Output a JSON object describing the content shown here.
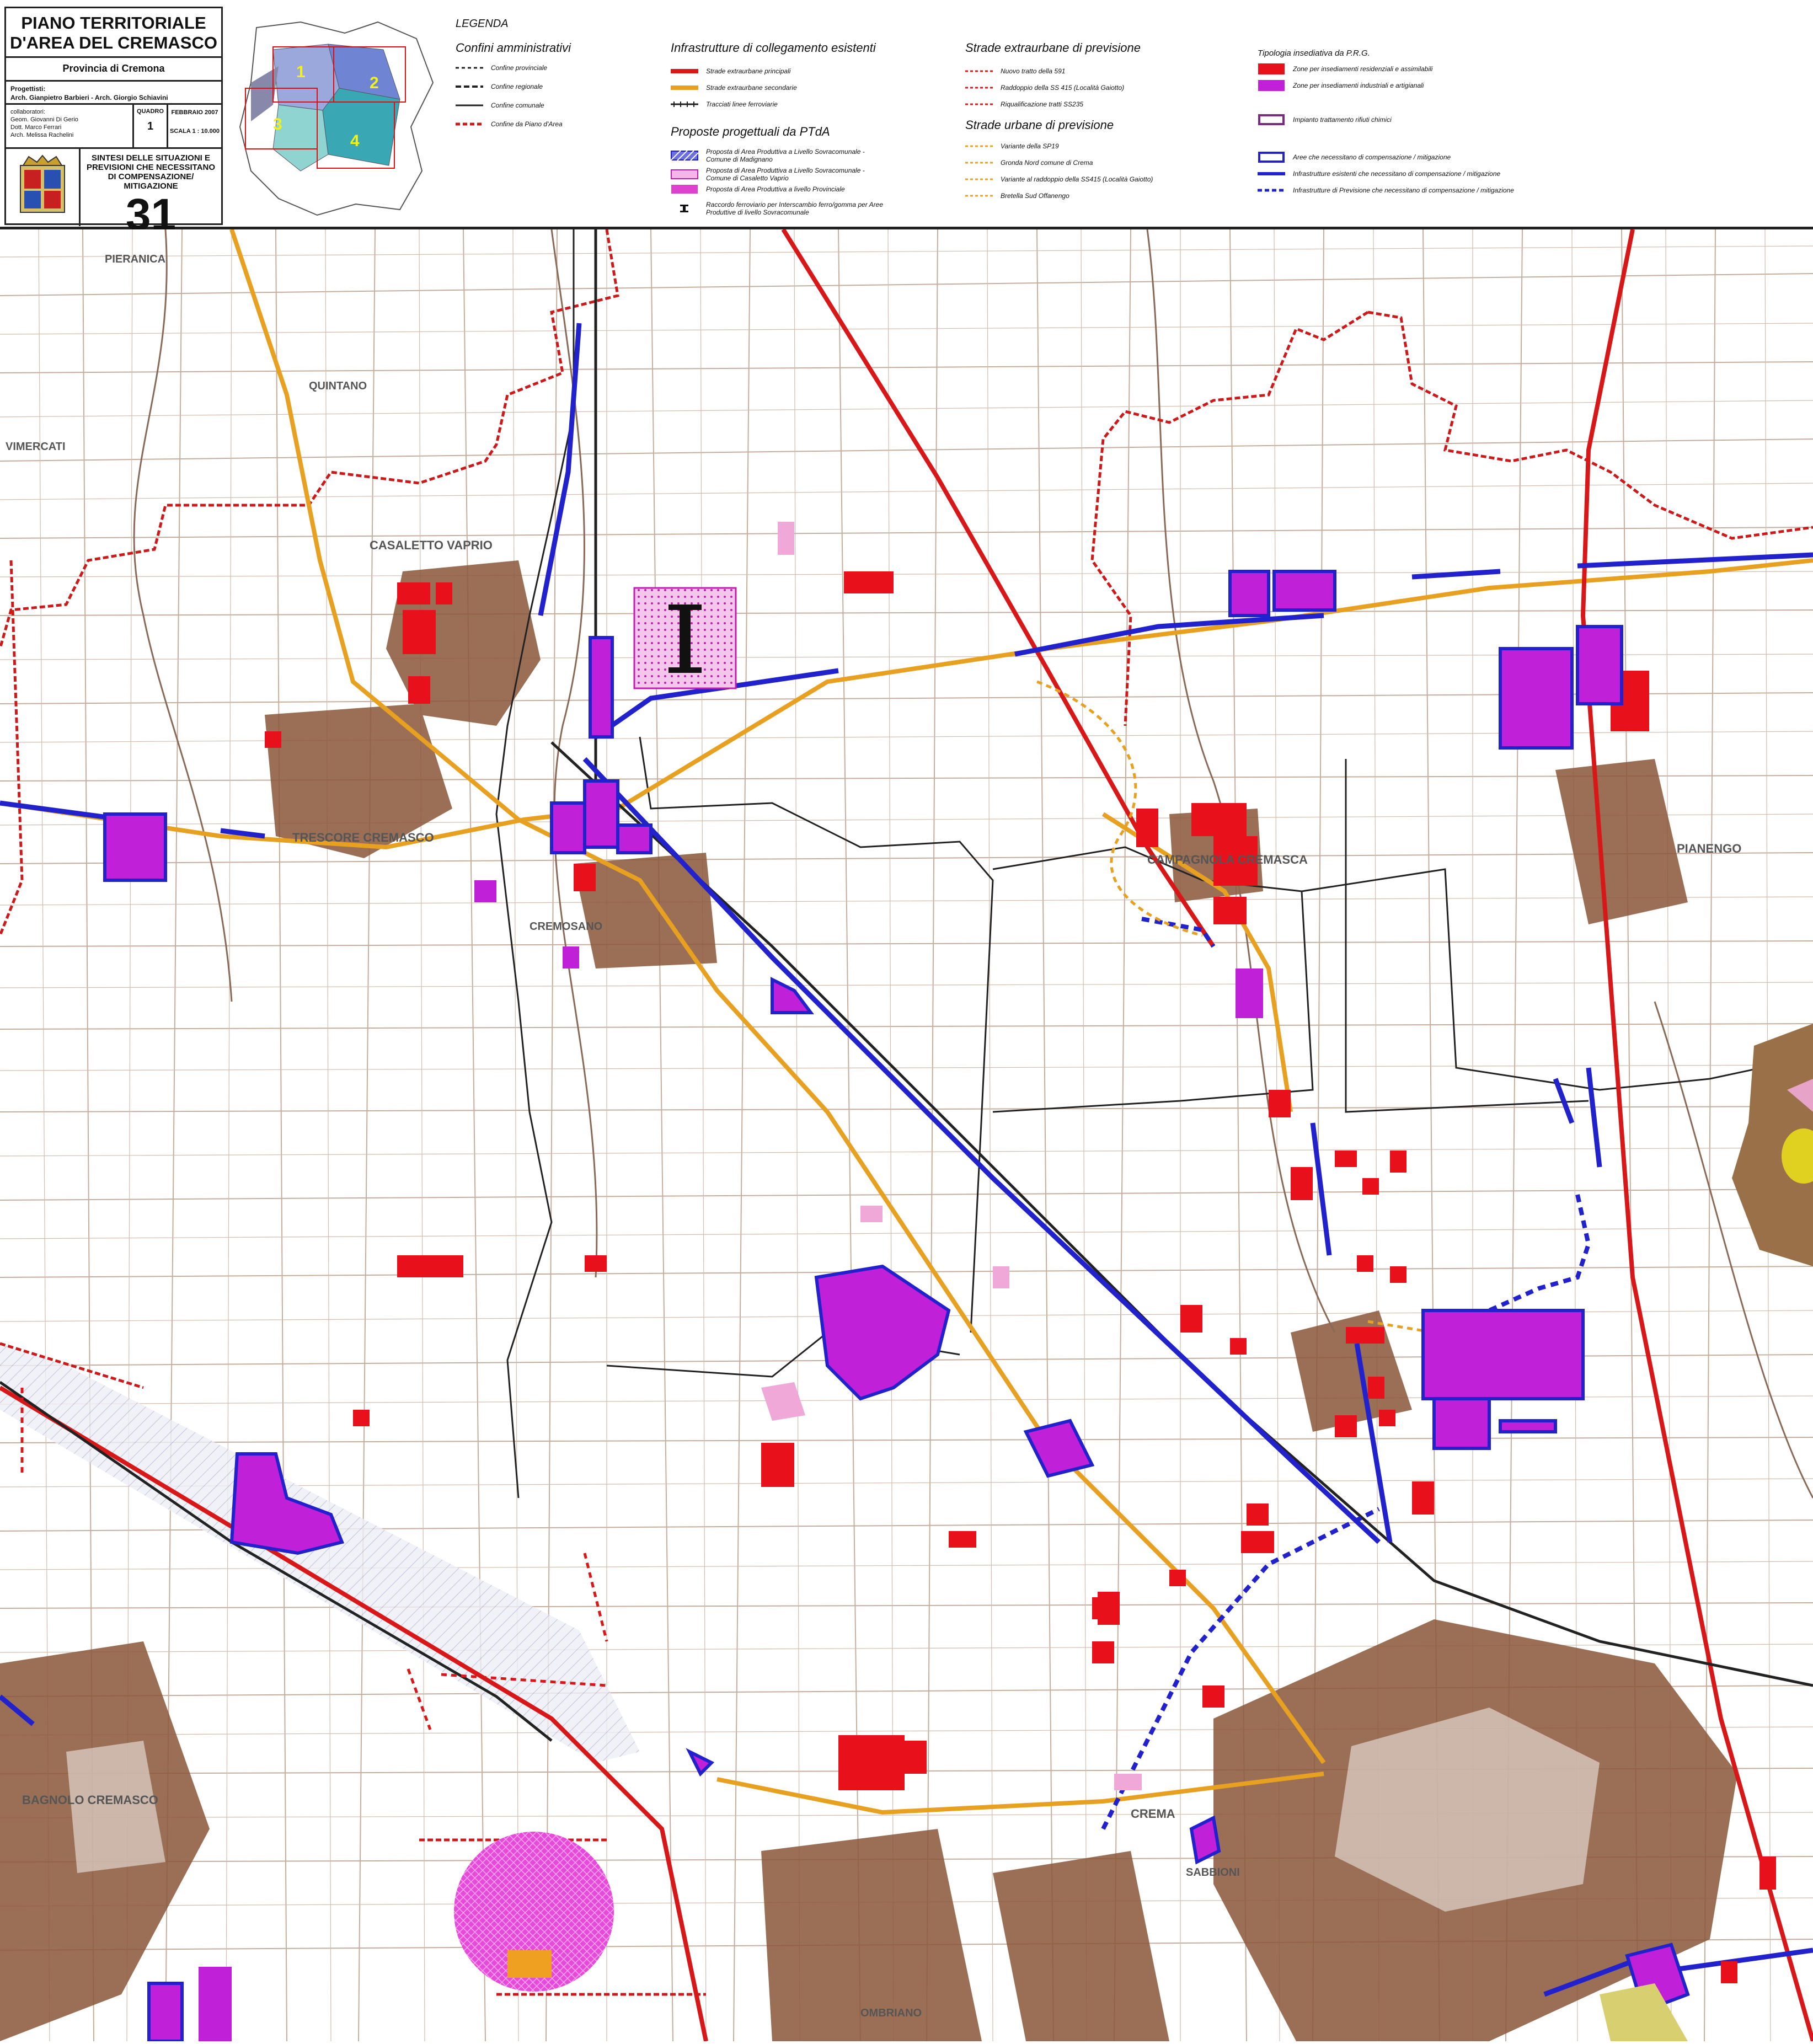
{
  "title_block": {
    "title_line1": "PIANO TERRITORIALE",
    "title_line2": "D'AREA DEL CREMASCO",
    "province": "Provincia di Cremona",
    "progettisti_label": "Progettisti:",
    "progettisti": "Arch. Gianpietro Barbieri - Arch. Giorgio Schiavini",
    "collaboratori_label": "collaboratori:",
    "collaboratori": [
      "Geom. Giovanni Di Gerio",
      "Dott. Marco Ferrari",
      "Arch. Melissa Rachelini"
    ],
    "quadro_label": "QUADRO",
    "quadro_value": "1",
    "date": "FEBBRAIO 2007",
    "scale": "SCALA 1 : 10.000",
    "sintesi": [
      "SINTESI DELLE SITUAZIONI E",
      "PREVISIONI CHE NECESSITANO",
      "DI COMPENSAZIONE/",
      "MITIGAZIONE"
    ],
    "sheet_number": "31",
    "crest_icon": "coat-of-arms-icon"
  },
  "key_map": {
    "quadrants": [
      "1",
      "2",
      "3",
      "4"
    ]
  },
  "legend": {
    "title": "LEGENDA",
    "confini": {
      "heading": "Confini amministrativi",
      "items": [
        "Confine provinciale",
        "Confine regionale",
        "Confine comunale",
        "Confine da Piano d'Area"
      ]
    },
    "infrastrutture": {
      "heading": "Infrastrutture di collegamento esistenti",
      "items": [
        "Strade extraurbane principali",
        "Strade extraurbane secondarie",
        "Tracciati linee ferroviarie"
      ]
    },
    "proposte": {
      "heading": "Proposte progettuali da PTdA",
      "items": [
        "Proposta di Area Produttiva a Livello Sovracomunale - Comune di Madignano",
        "Proposta di Area Produttiva a Livello Sovracomunale - Comune di Casaletto Vaprio",
        "Proposta di Area Produttiva a livello Provinciale",
        "Raccordo ferroviario per Interscambio ferro/gomma per Aree Produttive di livello Sovracomunale"
      ]
    },
    "extraurbane_previsione": {
      "heading": "Strade extraurbane di previsione",
      "items": [
        "Nuovo tratto della 591",
        "Raddoppio della SS 415 (Località Gaiotto)",
        "Riqualificazione tratti SS235"
      ]
    },
    "urbane_previsione": {
      "heading": "Strade urbane di previsione",
      "items": [
        "Variante della SP19",
        "Gronda Nord comune di Crema",
        "Variante al raddoppio della SS415 (Località Gaiotto)",
        "Bretella Sud Offanengo"
      ]
    },
    "tipologia": {
      "heading": "Tipologia insediativa da P.R.G.",
      "items": [
        "Zone per insediamenti residenziali e assimilabili",
        "Zone per insediamenti industriali e artigianali",
        "Impianto trattamento rifiuti chimici",
        "Aree che necessitano di compensazione / mitigazione",
        "Infrastrutture esistenti che necessitano di compensazione / mitigazione",
        "Infrastrutture di Previsione che necessitano di compensazione / mitigazione"
      ]
    }
  },
  "colors": {
    "residential": "#e8101a",
    "industrial": "#c020d8",
    "mitigation": "#2222cc",
    "road_primary": "#d81818",
    "road_secondary": "#e8a020",
    "map_lines": "#8a6a56",
    "urban": "#7a4a30",
    "boundary_red": "#cc1a1a"
  },
  "map": {
    "place_labels": [
      "PIERANICA",
      "QUINTANO",
      "VIMERCATI",
      "CASALETTO VAPRIO",
      "TRESCORE CREMASCO",
      "CREMOSANO",
      "CAMPAGNOLA CREMASCA",
      "PIANENGO",
      "CREMA",
      "BAGNOLO CREMASCO",
      "SABBIONI",
      "OMBRIANO"
    ]
  }
}
